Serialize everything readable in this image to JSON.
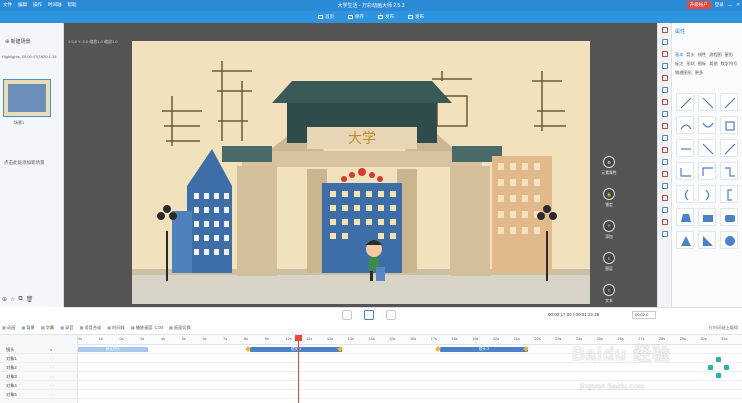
{
  "titlebar": {
    "menu": [
      "文件",
      "编辑",
      "操作",
      "时间轴",
      "帮助"
    ],
    "title": "大学生活 - 万彩动画大师 2.5.3",
    "upgrade": "升级帐户",
    "login": "登录"
  },
  "toolbar": {
    "items": [
      "首页",
      "保存",
      "发布",
      "发布"
    ]
  },
  "leftpanel": {
    "new_scene": "新建场景",
    "resolution": "Highlights, 00:00:17(1920:1.15",
    "thumb_caption": "场景1",
    "note": "点击此处添加新场景"
  },
  "rightpanel": {
    "title": "属性",
    "tabs": [
      "基本",
      "箭头",
      "线性",
      "流程图",
      "星形",
      "标注",
      "形状",
      "图标",
      "其他",
      "数学符号",
      "物理图形",
      "更多"
    ]
  },
  "canvas": {
    "ruler": "1:5.8 Y: 0.0  缩放1.0 缩放1.0",
    "gate_sign": "大学",
    "controls": [
      {
        "icon": "settings-icon",
        "label": "元素属性"
      },
      {
        "icon": "lock-icon",
        "label": "锁定"
      },
      {
        "icon": "add-icon",
        "label": "添加"
      },
      {
        "icon": "layer-icon",
        "label": "图层"
      },
      {
        "icon": "text-icon",
        "label": "文本"
      },
      {
        "icon": "scale-icon",
        "label": "缩放"
      }
    ]
  },
  "player": {
    "time": "00:00:17.00 / 00:01:22.25",
    "zoom": "00:02.0"
  },
  "timeline": {
    "toolbar": [
      "动画",
      "背景",
      "字幕",
      "录音",
      "语音合成",
      "时间线",
      "播放速度: 1.00",
      "画面切换"
    ],
    "hint": "在时间轴上编辑",
    "ticks": [
      "0s",
      "1s",
      "2s",
      "3s",
      "4s",
      "5s",
      "6s",
      "7s",
      "8s",
      "9s",
      "10s",
      "11s",
      "12s",
      "13s",
      "14s",
      "15s",
      "16s",
      "17s",
      "18s",
      "19s",
      "20s",
      "21s",
      "22s",
      "23s",
      "24s",
      "25s",
      "26s",
      "27s",
      "28s",
      "29s",
      "30s",
      "31s"
    ],
    "rows": [
      {
        "name": "镜头",
        "bars": [
          {
            "label": "默认镜头",
            "start": 0,
            "end": 8
          },
          {
            "label": "镜头 1",
            "start": 16,
            "end": 22
          },
          {
            "label": "镜头 2",
            "start": 33,
            "end": 38
          }
        ]
      },
      {
        "name": "对象1"
      },
      {
        "name": "对象2"
      },
      {
        "name": "对象3"
      },
      {
        "name": "对象4"
      },
      {
        "name": "对象5"
      }
    ]
  },
  "watermark": {
    "main": "Baidu 经验",
    "sub": "jingyan.baidu.com"
  }
}
